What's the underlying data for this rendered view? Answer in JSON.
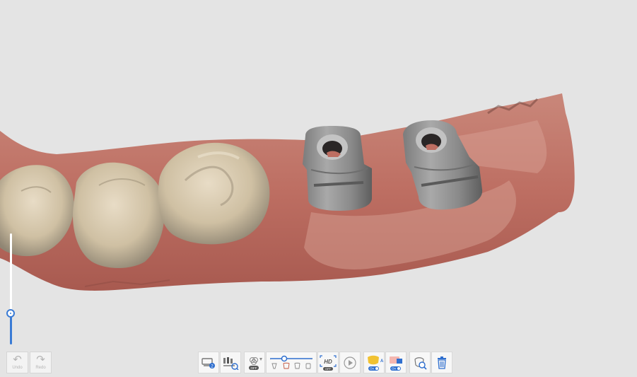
{
  "app": {
    "scene": "3D intraoral scan view",
    "accent_color": "#3a7bd5"
  },
  "history": {
    "undo_label": "Undo",
    "redo_label": "Redo"
  },
  "slider": {
    "level": 0.28
  },
  "toolbar": {
    "hd_label": "HD",
    "hd_state": "OFF",
    "color_state": "OFF",
    "ai_state": "On",
    "auto_state": "On",
    "icons": [
      "scan-stage-icon",
      "model-filter-icon",
      "texture-toggle-icon",
      "scan-range-slider-icon",
      "hd-mode-icon",
      "play-icon",
      "ai-scan-icon",
      "auto-lock-icon",
      "inspect-icon",
      "delete-icon"
    ]
  }
}
